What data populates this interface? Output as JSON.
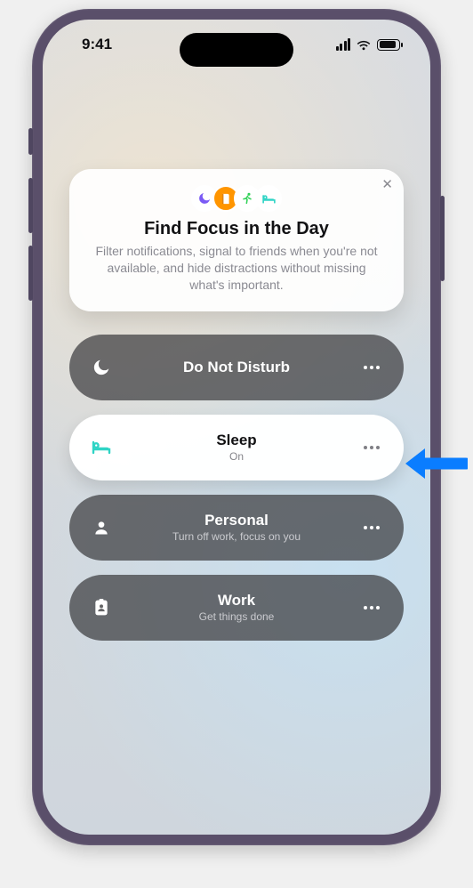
{
  "status": {
    "time": "9:41"
  },
  "intro": {
    "title": "Find Focus in the Day",
    "body": "Filter notifications, signal to friends when you're not available, and hide distractions without missing what's important."
  },
  "rows": [
    {
      "title": "Do Not Disturb",
      "sub": ""
    },
    {
      "title": "Sleep",
      "sub": "On"
    },
    {
      "title": "Personal",
      "sub": "Turn off work, focus on you"
    },
    {
      "title": "Work",
      "sub": "Get things done"
    }
  ],
  "colors": {
    "purple": "#7a5af5",
    "orange": "#ff9500",
    "green": "#31d158",
    "teal": "#2fd4c5"
  }
}
